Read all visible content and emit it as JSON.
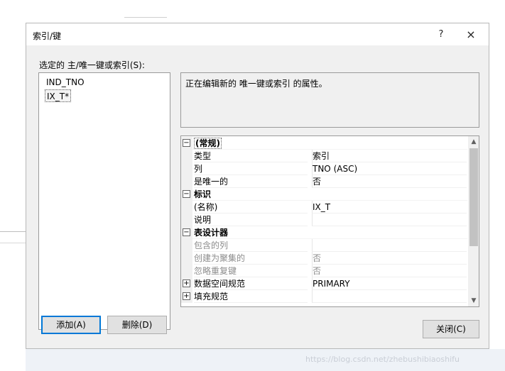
{
  "dialog": {
    "title": "索引/键",
    "help_label": "?",
    "close_glyph": "×"
  },
  "selection_label": "选定的 主/唯一键或索引(S):",
  "indexes": [
    {
      "label": "IND_TNO",
      "selected": false
    },
    {
      "label": "IX_T*",
      "selected": true
    }
  ],
  "description": "正在编辑新的 唯一键或索引 的属性。",
  "properties": {
    "general": {
      "label": "(常规)",
      "toggle": "⊟",
      "rows": [
        {
          "name": "类型",
          "value": "索引"
        },
        {
          "name": "列",
          "value": "TNO (ASC)"
        },
        {
          "name": "是唯一的",
          "value": "否"
        }
      ]
    },
    "identity": {
      "label": "标识",
      "toggle": "⊟",
      "rows": [
        {
          "name": "(名称)",
          "value": "IX_T"
        },
        {
          "name": "说明",
          "value": ""
        }
      ]
    },
    "table_designer": {
      "label": "表设计器",
      "toggle": "⊟",
      "rows": [
        {
          "name": "包含的列",
          "value": ""
        },
        {
          "name": "创建为聚集的",
          "value": "否"
        },
        {
          "name": "忽略重复键",
          "value": "否"
        }
      ]
    },
    "collapsed": [
      {
        "name": "数据空间规范",
        "value": "PRIMARY",
        "toggle": "⊞"
      },
      {
        "name": "填充规范",
        "value": "",
        "toggle": "⊞"
      }
    ]
  },
  "buttons": {
    "add": "添加(A)",
    "delete": "删除(D)",
    "close": "关闭(C)"
  },
  "watermark": "https://blog.csdn.net/zhebushibiaoshifu",
  "scroll": {
    "up": "▲",
    "down": "▼"
  }
}
